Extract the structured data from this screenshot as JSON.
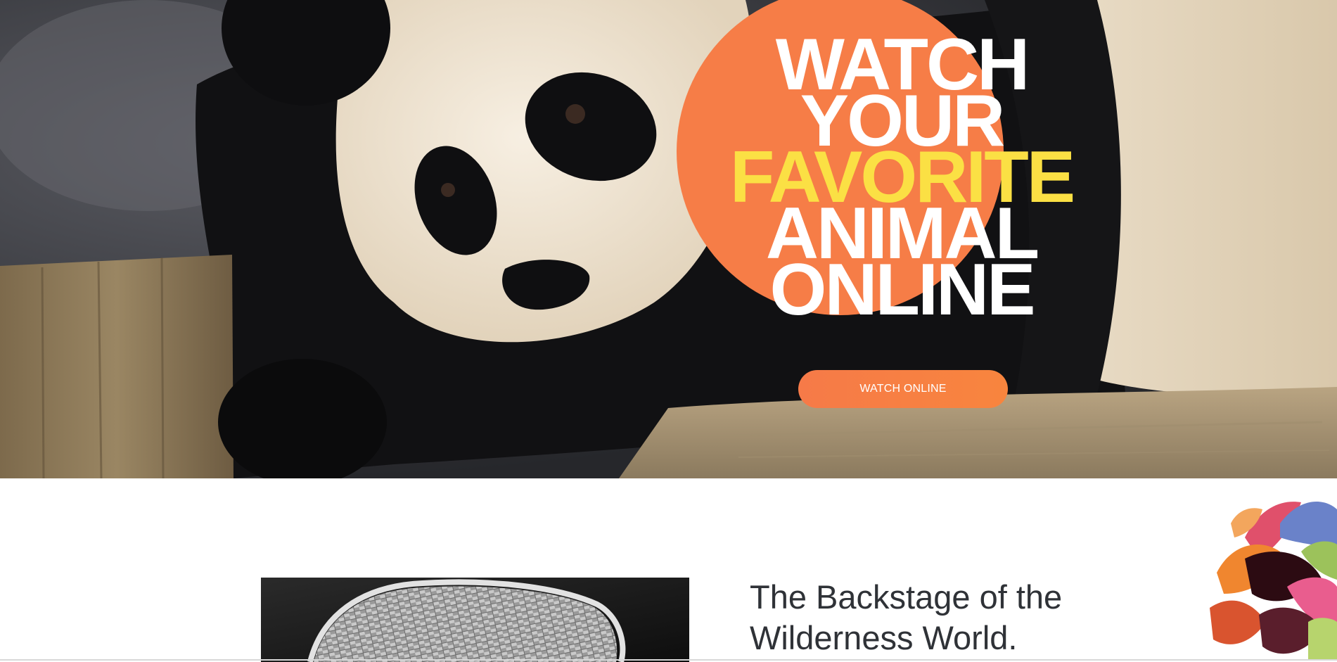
{
  "hero": {
    "image_subject": "giant-panda",
    "heading": {
      "line1": "WATCH",
      "line2": "YOUR",
      "line3": "FAVORITE",
      "line4": "ANIMAL",
      "line5": "ONLINE"
    },
    "button_label": "WATCH ONLINE",
    "colors": {
      "accent_circle": "#f67d47",
      "highlight_text": "#fbe044",
      "heading_text": "#ffffff"
    }
  },
  "backstage": {
    "title": "The Backstage of the Wilderness World.",
    "image_subject": "woven-basket-monochrome",
    "decoration": "autumn-leaves"
  }
}
